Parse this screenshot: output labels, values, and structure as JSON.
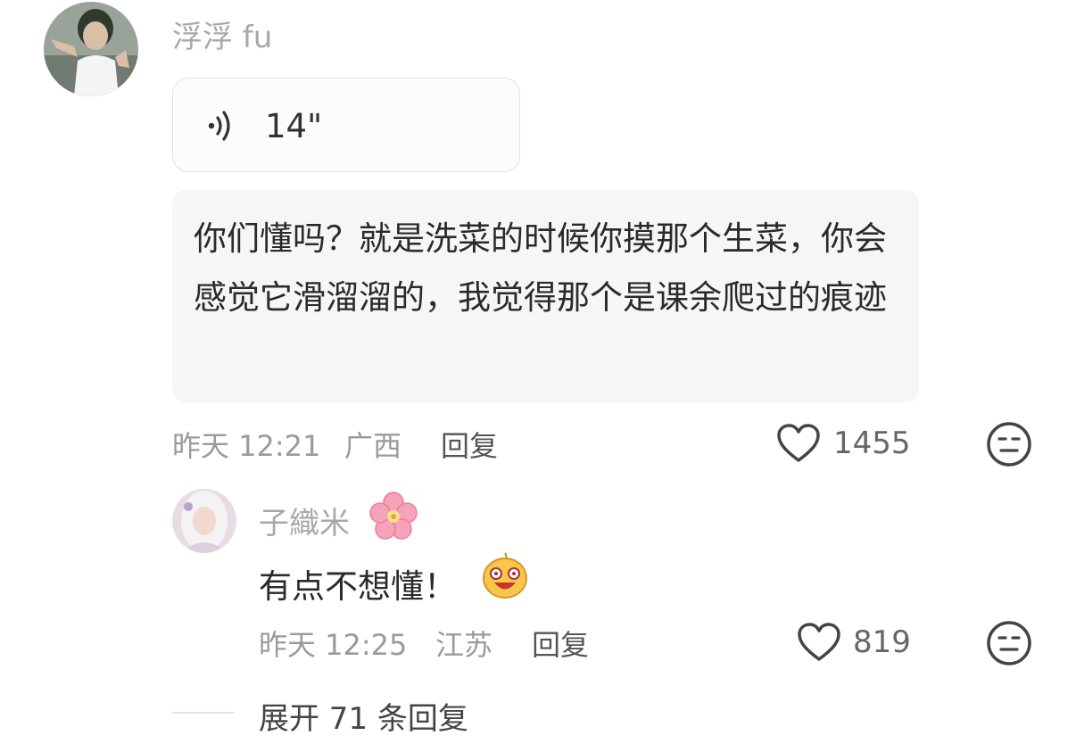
{
  "comment": {
    "username": "浮浮 fu",
    "voice": {
      "duration": "14\""
    },
    "text": "你们懂吗？就是洗菜的时候你摸那个生菜，你会感觉它滑溜溜的，我觉得那个是课余爬过的痕迹",
    "time": "昨天 12:21",
    "location": "广西",
    "reply_label": "回复",
    "likes": "1455"
  },
  "reply": {
    "username": "子織米",
    "text": "有点不想懂！",
    "time": "昨天 12:25",
    "location": "江苏",
    "reply_label": "回复",
    "likes": "819"
  },
  "expand_label": "展开 71 条回复",
  "icons": {
    "comment_avatar": "avatar-photo",
    "reply_avatar": "avatar-photo",
    "voice": "voice-wave-icon",
    "like": "heart-outline-icon",
    "dislike": "meh-face-icon",
    "flower": "cherry-blossom-emoji",
    "laugh": "laughing-emoji"
  }
}
